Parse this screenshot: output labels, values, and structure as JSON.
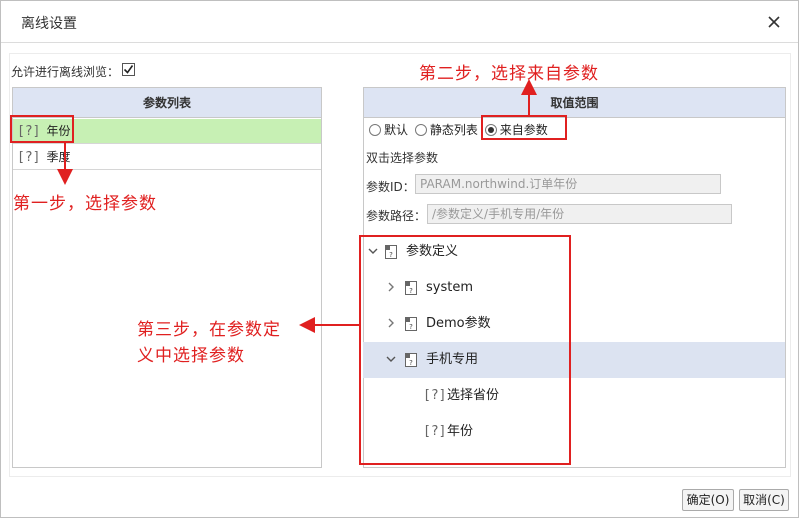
{
  "window": {
    "title": "离线设置"
  },
  "allow_offline_label": "允许进行离线浏览：",
  "allow_offline_checked": true,
  "params_panel": {
    "header": "参数列表",
    "items": [
      {
        "label": "年份",
        "selected": true
      },
      {
        "label": "季度",
        "selected": false
      }
    ]
  },
  "range_panel": {
    "header": "取值范围",
    "radios": [
      {
        "label": "默认",
        "checked": false
      },
      {
        "label": "静态列表",
        "checked": false
      },
      {
        "label": "来自参数",
        "checked": true
      }
    ],
    "double_click_hint": "双击选择参数",
    "param_id_label": "参数ID：",
    "param_id_value": "PARAM.northwind.订单年份",
    "param_path_label": "参数路径：",
    "param_path_value": "/参数定义/手机专用/年份",
    "tree": {
      "root": "参数定义",
      "children": [
        {
          "label": "system",
          "expanded": false
        },
        {
          "label": "Demo参数",
          "expanded": false
        },
        {
          "label": "手机专用",
          "expanded": true,
          "selected": true,
          "children": [
            {
              "label": "选择省份"
            },
            {
              "label": "年份"
            }
          ]
        }
      ]
    }
  },
  "annotations": {
    "step1": "第一步，选择参数",
    "step2": "第二步，选择来自参数",
    "step3_line1": "第三步，在参数定",
    "step3_line2": "义中选择参数"
  },
  "buttons": {
    "ok": "确定(O)",
    "cancel": "取消(C)"
  },
  "colors": {
    "annotation_red": "#e02020",
    "header_bg": "#dde4f3",
    "selected_row_bg": "#c7f0b4",
    "tree_selected_bg": "#dce3f1"
  }
}
